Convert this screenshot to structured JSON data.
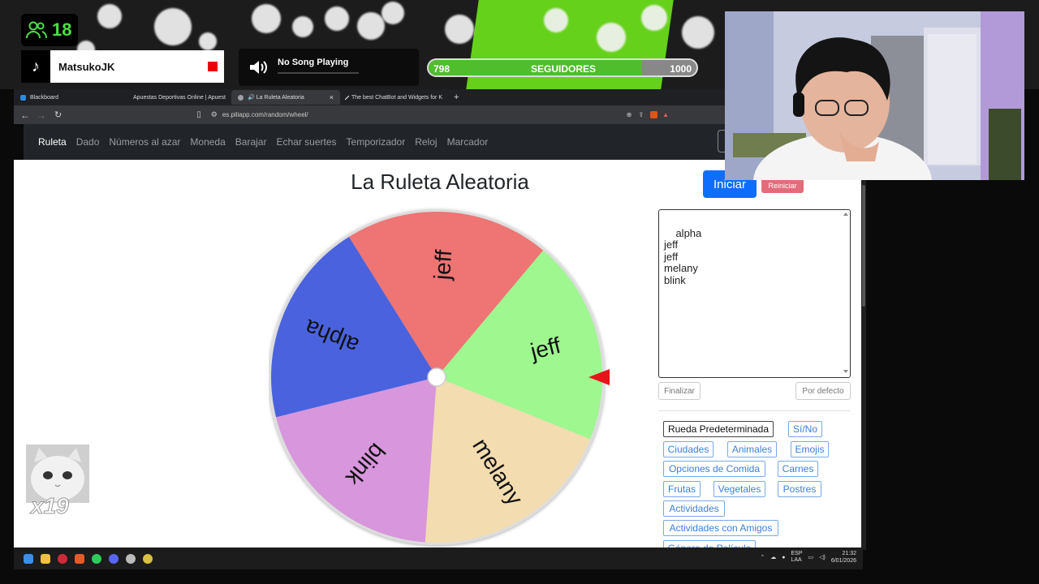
{
  "overlay": {
    "viewer_count": "18",
    "tiktok_user": "MatsukoJK",
    "song": "No Song Playing",
    "followers": {
      "current": "798",
      "label": "SEGUIDORES",
      "goal": "1000",
      "progress": 0.798
    },
    "cat_multiplier": "x19"
  },
  "browser": {
    "tabs": [
      {
        "label": "Blackboard",
        "color": "#2a8bdf"
      },
      {
        "label": "Apuestas Deportivas Online | Apuest",
        "color": "#d0181a"
      },
      {
        "label": "🔊 La Ruleta Aleatoria",
        "color": "#9aa0a6",
        "close": "×"
      },
      {
        "label": "The best ChatBot and Widgets for K",
        "color": "#eeeeee"
      }
    ],
    "new_tab": "+",
    "url": "es.piliapp.com/random/wheel/"
  },
  "nav": {
    "items": [
      "Ruleta",
      "Dado",
      "Números al azar",
      "Moneda",
      "Barajar",
      "Echar suertes",
      "Temporizador",
      "Reloj",
      "Marcador"
    ]
  },
  "main": {
    "title": "La Ruleta Aleatoria",
    "start_button": "Iniciar",
    "reset_button": "Reiniciar",
    "names_text": "alpha\njeff\njeff\nmelany\nblink",
    "finish_button": "Finalizar",
    "default_button": "Por defecto"
  },
  "wheel": {
    "segments": [
      {
        "label": "jeff",
        "color": "#ef7474"
      },
      {
        "label": "jeff",
        "color": "#9ef78f"
      },
      {
        "label": "melany",
        "color": "#f3dcaf"
      },
      {
        "label": "blink",
        "color": "#d896dc"
      },
      {
        "label": "alpha",
        "color": "#4a62dd"
      }
    ],
    "pointer_color": "#e8141b"
  },
  "presets": [
    "Rueda Predeterminada",
    "Sí/No",
    "Ciudades",
    "Animales",
    "Emojis",
    "Opciones de Comida",
    "Carnes",
    "Frutas",
    "Vegetales",
    "Postres",
    "Actividades",
    "Actividades con Amigos",
    "Género de Película"
  ],
  "taskbar": {
    "lang": "ESP",
    "lang2": "LAA",
    "time": "21:32",
    "date": "6/01/2026"
  }
}
